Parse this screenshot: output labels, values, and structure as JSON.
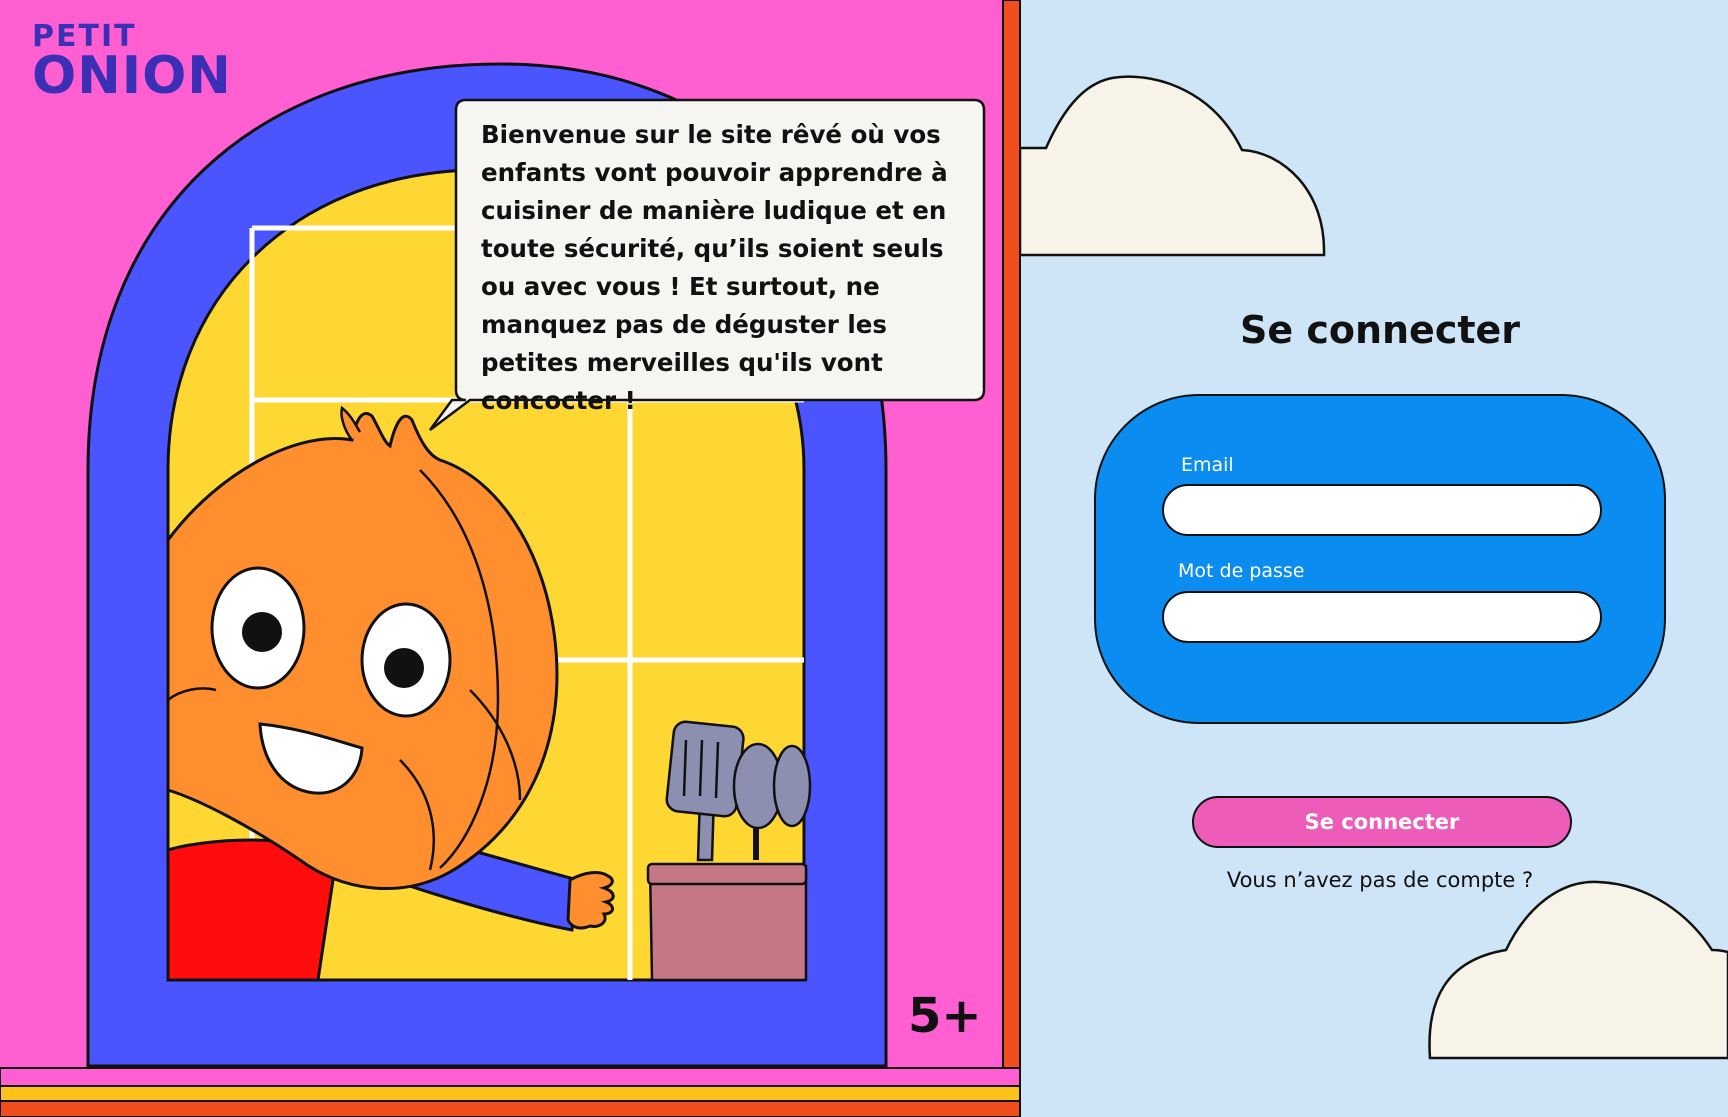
{
  "brand": {
    "logo_line1": "PETIT",
    "logo_line2": "ONION"
  },
  "hero": {
    "speech_bubble": "Bienvenue sur le site rêvé où vos enfants vont pouvoir apprendre à cuisiner de manière ludique et en toute sécurité, qu’ils soient seuls ou avec vous ! Et surtout, ne manquez pas de déguster les petites merveilles qu'ils vont concocter !",
    "age_badge": "5+"
  },
  "login": {
    "title": "Se connecter",
    "email_label": "Email",
    "email_value": "",
    "password_label": "Mot de passe",
    "password_value": "",
    "submit_label": "Se connecter",
    "signup_link": "Vous n’avez pas de compte ?"
  },
  "colors": {
    "left_panel": "#ff5fd1",
    "sky": "#cde5f7",
    "arch": "#4a55ff",
    "window": "#ffd733",
    "onion": "#ff8f2e",
    "form_card": "#0a8cf0",
    "submit_button": "#ee5cba",
    "cloud": "#f7f3e8",
    "logo": "#3b2fb5"
  }
}
